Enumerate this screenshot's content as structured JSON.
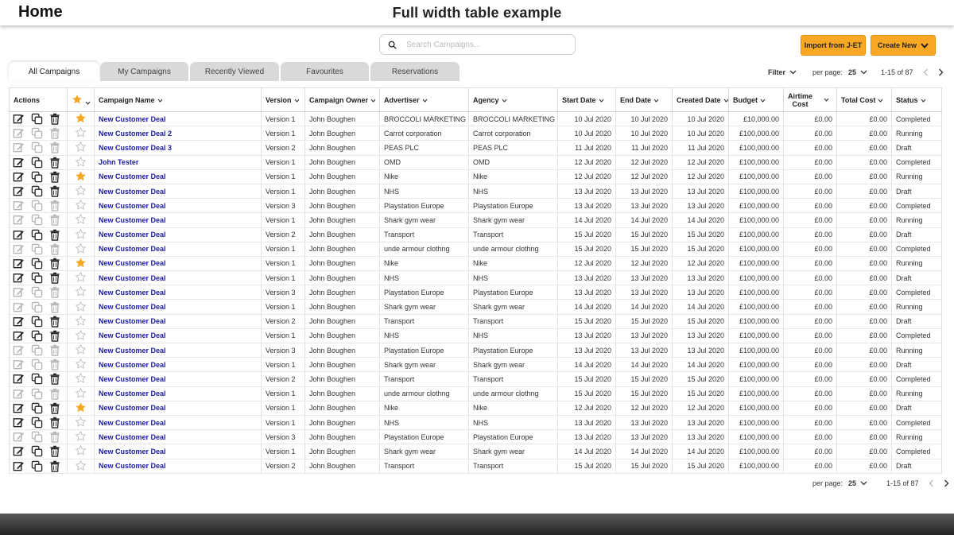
{
  "header": {
    "home": "Home",
    "title": "Full width table example"
  },
  "search": {
    "placeholder": "Search Campaigns..."
  },
  "toolbar": {
    "import_label": "Import from J-ET",
    "create_label": "Create New"
  },
  "tabs": [
    "All Campaigns",
    "My Campaigns",
    "Recently Viewed",
    "Favourites",
    "Reservations"
  ],
  "pager_top": {
    "filter": "Filter",
    "per_page_label": "per page:",
    "per_page_value": "25",
    "range": "1-15 of 87"
  },
  "pager_bottom": {
    "per_page_label": "per page:",
    "per_page_value": "25",
    "range": "1-15 of 87"
  },
  "columns": {
    "actions": "Actions",
    "campaign_name": "Campaign Name",
    "version": "Version",
    "owner": "Campaign Owner",
    "advertiser": "Advertiser",
    "agency": "Agency",
    "start": "Start Date",
    "end": "End Date",
    "created": "Created Date",
    "budget": "Budget",
    "airtime_1": "Airtime",
    "airtime_2": "Cost",
    "total": "Total Cost",
    "status": "Status"
  },
  "colors": {
    "accent": "#f9a825",
    "link": "#1a1aa6",
    "star_on": "#f5a623"
  },
  "rows": [
    {
      "active": true,
      "fav": true,
      "name": "New Customer Deal",
      "version": "Version 1",
      "owner": "John Boughen",
      "advertiser": "BROCCOLI MARKETING",
      "agency": "BROCCOLI MARKETING",
      "start": "10 Jul 2020",
      "end": "10 Jul 2020",
      "created": "10 Jul 2020",
      "budget": "£10,000.00",
      "airtime": "£0.00",
      "total": "£0.00",
      "status": "Completed"
    },
    {
      "active": false,
      "fav": false,
      "name": "New Customer Deal 2",
      "version": "Version 1",
      "owner": "John Boughen",
      "advertiser": "Carrot corporation",
      "agency": "Carrot corporation",
      "start": "10 Jul 2020",
      "end": "10 Jul 2020",
      "created": "10 Jul 2020",
      "budget": "£100,000.00",
      "airtime": "£0.00",
      "total": "£0.00",
      "status": "Running"
    },
    {
      "active": false,
      "fav": false,
      "name": "New Customer Deal 3",
      "version": "Version 2",
      "owner": "John Boughen",
      "advertiser": "PEAS PLC",
      "agency": "PEAS PLC",
      "start": "11 Jul 2020",
      "end": "11 Jul 2020",
      "created": "11 Jul 2020",
      "budget": "£100,000.00",
      "airtime": "£0.00",
      "total": "£0.00",
      "status": "Draft"
    },
    {
      "active": true,
      "fav": false,
      "name": "John Tester",
      "version": "Version 1",
      "owner": "John Boughen",
      "advertiser": "OMD",
      "agency": "OMD",
      "start": "12 Jul 2020",
      "end": "12 Jul 2020",
      "created": "12 Jul 2020",
      "budget": "£100,000.00",
      "airtime": "£0.00",
      "total": "£0.00",
      "status": "Completed"
    },
    {
      "active": true,
      "fav": true,
      "name": "New Customer Deal",
      "version": "Version 1",
      "owner": "John Boughen",
      "advertiser": "Nike",
      "agency": "Nike",
      "start": "12 Jul 2020",
      "end": "12 Jul 2020",
      "created": "12 Jul 2020",
      "budget": "£100,000.00",
      "airtime": "£0.00",
      "total": "£0.00",
      "status": "Running"
    },
    {
      "active": true,
      "fav": false,
      "name": "New Customer Deal",
      "version": "Version 1",
      "owner": "John Boughen",
      "advertiser": "NHS",
      "agency": "NHS",
      "start": "13 Jul 2020",
      "end": "13 Jul 2020",
      "created": "13 Jul 2020",
      "budget": "£100,000.00",
      "airtime": "£0.00",
      "total": "£0.00",
      "status": "Draft"
    },
    {
      "active": false,
      "fav": false,
      "name": "New Customer Deal",
      "version": "Version 3",
      "owner": "John Boughen",
      "advertiser": "Playstation Europe",
      "agency": "Playstation Europe",
      "start": "13 Jul 2020",
      "end": "13 Jul 2020",
      "created": "13 Jul 2020",
      "budget": "£100,000.00",
      "airtime": "£0.00",
      "total": "£0.00",
      "status": "Completed"
    },
    {
      "active": false,
      "fav": false,
      "name": "New Customer Deal",
      "version": "Version 1",
      "owner": "John Boughen",
      "advertiser": "Shark gym wear",
      "agency": "Shark gym wear",
      "start": "14 Jul 2020",
      "end": "14 Jul 2020",
      "created": "14 Jul 2020",
      "budget": "£100,000.00",
      "airtime": "£0.00",
      "total": "£0.00",
      "status": "Running"
    },
    {
      "active": true,
      "fav": false,
      "name": "New Customer Deal",
      "version": "Version 2",
      "owner": "John Boughen",
      "advertiser": "Transport",
      "agency": "Transport",
      "start": "15 Jul 2020",
      "end": "15 Jul 2020",
      "created": "15 Jul 2020",
      "budget": "£100,000.00",
      "airtime": "£0.00",
      "total": "£0.00",
      "status": "Draft"
    },
    {
      "active": false,
      "fav": false,
      "name": "New Customer Deal",
      "version": "Version 1",
      "owner": "John Boughen",
      "advertiser": "unde armour clothng",
      "agency": "unde armour clothng",
      "start": "15 Jul 2020",
      "end": "15 Jul 2020",
      "created": "15 Jul 2020",
      "budget": "£100,000.00",
      "airtime": "£0.00",
      "total": "£0.00",
      "status": "Completed"
    },
    {
      "active": true,
      "fav": true,
      "name": "New Customer Deal",
      "version": "Version 1",
      "owner": "John Boughen",
      "advertiser": "Nike",
      "agency": "Nike",
      "start": "12 Jul 2020",
      "end": "12 Jul 2020",
      "created": "12 Jul 2020",
      "budget": "£100,000.00",
      "airtime": "£0.00",
      "total": "£0.00",
      "status": "Running"
    },
    {
      "active": true,
      "fav": false,
      "name": "New Customer Deal",
      "version": "Version 1",
      "owner": "John Boughen",
      "advertiser": "NHS",
      "agency": "NHS",
      "start": "13 Jul 2020",
      "end": "13 Jul 2020",
      "created": "13 Jul 2020",
      "budget": "£100,000.00",
      "airtime": "£0.00",
      "total": "£0.00",
      "status": "Draft"
    },
    {
      "active": false,
      "fav": false,
      "name": "New Customer Deal",
      "version": "Version 3",
      "owner": "John Boughen",
      "advertiser": "Playstation Europe",
      "agency": "Playstation Europe",
      "start": "13 Jul 2020",
      "end": "13 Jul 2020",
      "created": "13 Jul 2020",
      "budget": "£100,000.00",
      "airtime": "£0.00",
      "total": "£0.00",
      "status": "Completed"
    },
    {
      "active": false,
      "fav": false,
      "name": "New Customer Deal",
      "version": "Version 1",
      "owner": "John Boughen",
      "advertiser": "Shark gym wear",
      "agency": "Shark gym wear",
      "start": "14 Jul 2020",
      "end": "14 Jul 2020",
      "created": "14 Jul 2020",
      "budget": "£100,000.00",
      "airtime": "£0.00",
      "total": "£0.00",
      "status": "Running"
    },
    {
      "active": true,
      "fav": false,
      "name": "New Customer Deal",
      "version": "Version 2",
      "owner": "John Boughen",
      "advertiser": "Transport",
      "agency": "Transport",
      "start": "15 Jul 2020",
      "end": "15 Jul 2020",
      "created": "15 Jul 2020",
      "budget": "£100,000.00",
      "airtime": "£0.00",
      "total": "£0.00",
      "status": "Draft"
    },
    {
      "active": true,
      "fav": false,
      "name": "New Customer Deal",
      "version": "Version 1",
      "owner": "John Boughen",
      "advertiser": "NHS",
      "agency": "NHS",
      "start": "13 Jul 2020",
      "end": "13 Jul 2020",
      "created": "13 Jul 2020",
      "budget": "£100,000.00",
      "airtime": "£0.00",
      "total": "£0.00",
      "status": "Completed"
    },
    {
      "active": false,
      "fav": false,
      "name": "New Customer Deal",
      "version": "Version 3",
      "owner": "John Boughen",
      "advertiser": "Playstation Europe",
      "agency": "Playstation Europe",
      "start": "13 Jul 2020",
      "end": "13 Jul 2020",
      "created": "13 Jul 2020",
      "budget": "£100,000.00",
      "airtime": "£0.00",
      "total": "£0.00",
      "status": "Running"
    },
    {
      "active": false,
      "fav": false,
      "name": "New Customer Deal",
      "version": "Version 1",
      "owner": "John Boughen",
      "advertiser": "Shark gym wear",
      "agency": "Shark gym wear",
      "start": "14 Jul 2020",
      "end": "14 Jul 2020",
      "created": "14 Jul 2020",
      "budget": "£100,000.00",
      "airtime": "£0.00",
      "total": "£0.00",
      "status": "Draft"
    },
    {
      "active": true,
      "fav": false,
      "name": "New Customer Deal",
      "version": "Version 2",
      "owner": "John Boughen",
      "advertiser": "Transport",
      "agency": "Transport",
      "start": "15 Jul 2020",
      "end": "15 Jul 2020",
      "created": "15 Jul 2020",
      "budget": "£100,000.00",
      "airtime": "£0.00",
      "total": "£0.00",
      "status": "Completed"
    },
    {
      "active": false,
      "fav": false,
      "name": "New Customer Deal",
      "version": "Version 1",
      "owner": "John Boughen",
      "advertiser": "unde armour clothng",
      "agency": "unde armour clothng",
      "start": "15 Jul 2020",
      "end": "15 Jul 2020",
      "created": "15 Jul 2020",
      "budget": "£100,000.00",
      "airtime": "£0.00",
      "total": "£0.00",
      "status": "Running"
    },
    {
      "active": true,
      "fav": true,
      "name": "New Customer Deal",
      "version": "Version 1",
      "owner": "John Boughen",
      "advertiser": "Nike",
      "agency": "Nike",
      "start": "12 Jul 2020",
      "end": "12 Jul 2020",
      "created": "12 Jul 2020",
      "budget": "£100,000.00",
      "airtime": "£0.00",
      "total": "£0.00",
      "status": "Draft"
    },
    {
      "active": true,
      "fav": false,
      "name": "New Customer Deal",
      "version": "Version 1",
      "owner": "John Boughen",
      "advertiser": "NHS",
      "agency": "NHS",
      "start": "13 Jul 2020",
      "end": "13 Jul 2020",
      "created": "13 Jul 2020",
      "budget": "£100,000.00",
      "airtime": "£0.00",
      "total": "£0.00",
      "status": "Completed"
    },
    {
      "active": false,
      "fav": false,
      "name": "New Customer Deal",
      "version": "Version 3",
      "owner": "John Boughen",
      "advertiser": "Playstation Europe",
      "agency": "Playstation Europe",
      "start": "13 Jul 2020",
      "end": "13 Jul 2020",
      "created": "13 Jul 2020",
      "budget": "£100,000.00",
      "airtime": "£0.00",
      "total": "£0.00",
      "status": "Running"
    },
    {
      "active": true,
      "fav": false,
      "name": "New Customer Deal",
      "version": "Version 1",
      "owner": "John Boughen",
      "advertiser": "Shark gym wear",
      "agency": "Shark gym wear",
      "start": "14 Jul 2020",
      "end": "14 Jul 2020",
      "created": "14 Jul 2020",
      "budget": "£100,000.00",
      "airtime": "£0.00",
      "total": "£0.00",
      "status": "Completed"
    },
    {
      "active": true,
      "fav": false,
      "name": "New Customer Deal",
      "version": "Version 2",
      "owner": "John Boughen",
      "advertiser": "Transport",
      "agency": "Transport",
      "start": "15 Jul 2020",
      "end": "15 Jul 2020",
      "created": "15 Jul 2020",
      "budget": "£100,000.00",
      "airtime": "£0.00",
      "total": "£0.00",
      "status": "Draft"
    }
  ]
}
